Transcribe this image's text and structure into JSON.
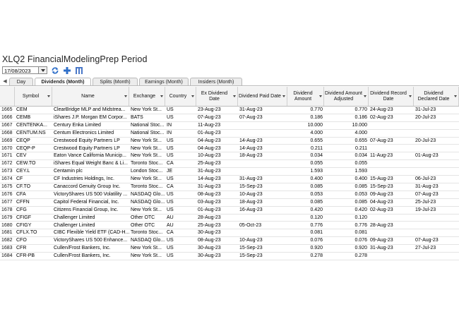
{
  "window": {
    "title": "XLQ2 FinancialModelingPrep Period"
  },
  "toolbar": {
    "date_value": "17/08/2023",
    "icons": [
      "calendar-dropdown-icon",
      "refresh-icon",
      "add-icon",
      "columns-icon"
    ],
    "colors": {
      "refresh": "#2f6fc9",
      "add": "#2f6fc9",
      "columns": "#4a78c8"
    }
  },
  "tabs": [
    {
      "label": "Day"
    },
    {
      "label": "Dividends (Month)",
      "active": true
    },
    {
      "label": "Splits (Month)"
    },
    {
      "label": "Earnings (Month)"
    },
    {
      "label": "Insiders (Month)"
    }
  ],
  "columns": [
    {
      "label": "",
      "filter": false
    },
    {
      "label": "Symbol",
      "filter": true
    },
    {
      "label": "Name",
      "filter": true
    },
    {
      "label": "Exchange",
      "filter": true
    },
    {
      "label": "Country",
      "filter": true
    },
    {
      "label": "Ex Dividend Date",
      "filter": true
    },
    {
      "label": "Dividend Paid Date",
      "filter": true
    },
    {
      "label": "Dividend Amount",
      "filter": true
    },
    {
      "label": "Dividend Amount Adjusted",
      "filter": true
    },
    {
      "label": "Dividend Record Date",
      "filter": true
    },
    {
      "label": "Dividend Declared Date",
      "filter": true
    }
  ],
  "rows": [
    [
      "1665",
      "CEM",
      "ClearBridge MLP and Midstrea...",
      "New York St...",
      "US",
      "23-Aug-23",
      "31-Aug-23",
      "0.770",
      "0.770",
      "24-Aug-23",
      "31-Jul-23"
    ],
    [
      "1666",
      "CEMB",
      "iShares J.P. Morgan EM Corpor...",
      "BATS",
      "US",
      "07-Aug-23",
      "07-Aug-23",
      "0.186",
      "0.186",
      "02-Aug-23",
      "20-Jul-23"
    ],
    [
      "1667",
      "CENTENKA...",
      "Century Enka Limited",
      "National Stoc...",
      "IN",
      "11-Aug-23",
      "",
      "10.000",
      "10.000",
      "",
      ""
    ],
    [
      "1668",
      "CENTUM.NS",
      "Centum Electronics Limited",
      "National Stoc...",
      "IN",
      "01-Aug-23",
      "",
      "4.000",
      "4.000",
      "",
      ""
    ],
    [
      "1669",
      "CEQP",
      "Crestwood Equity Partners LP",
      "New York St...",
      "US",
      "04-Aug-23",
      "14-Aug-23",
      "0.655",
      "0.655",
      "07-Aug-23",
      "20-Jul-23"
    ],
    [
      "1670",
      "CEQP-P",
      "Crestwood Equity Partners LP",
      "New York St...",
      "US",
      "04-Aug-23",
      "14-Aug-23",
      "0.211",
      "0.211",
      "",
      ""
    ],
    [
      "1671",
      "CEV",
      "Eaton Vance California Municip...",
      "New York St...",
      "US",
      "10-Aug-23",
      "18-Aug-23",
      "0.034",
      "0.034",
      "11-Aug-23",
      "01-Aug-23"
    ],
    [
      "1672",
      "CEW.TO",
      "iShares Equal Weight Banc & Li...",
      "Toronto Stoc...",
      "CA",
      "25-Aug-23",
      "",
      "0.055",
      "0.055",
      "",
      ""
    ],
    [
      "1673",
      "CEY.L",
      "Centamin plc",
      "London Stoc...",
      "JE",
      "31-Aug-23",
      "",
      "1.593",
      "1.593",
      "",
      ""
    ],
    [
      "1674",
      "CF",
      "CF Industries Holdings, Inc.",
      "New York St...",
      "US",
      "14-Aug-23",
      "31-Aug-23",
      "0.400",
      "0.400",
      "15-Aug-23",
      "06-Jul-23"
    ],
    [
      "1675",
      "CF.TO",
      "Canaccord Genuity Group Inc.",
      "Toronto Stoc...",
      "CA",
      "31-Aug-23",
      "15-Sep-23",
      "0.085",
      "0.085",
      "15-Sep-23",
      "31-Aug-23"
    ],
    [
      "1676",
      "CFA",
      "VictoryShares US 500 Volatility ...",
      "NASDAQ Glo...",
      "US",
      "08-Aug-23",
      "10-Aug-23",
      "0.053",
      "0.053",
      "09-Aug-23",
      "07-Aug-23"
    ],
    [
      "1677",
      "CFFN",
      "Capitol Federal Financial, Inc.",
      "NASDAQ Glo...",
      "US",
      "03-Aug-23",
      "18-Aug-23",
      "0.085",
      "0.085",
      "04-Aug-23",
      "25-Jul-23"
    ],
    [
      "1678",
      "CFG",
      "Citizens Financial Group, Inc.",
      "New York St...",
      "US",
      "01-Aug-23",
      "16-Aug-23",
      "0.420",
      "0.420",
      "02-Aug-23",
      "19-Jul-23"
    ],
    [
      "1679",
      "CFIGF",
      "Challenger Limited",
      "Other OTC",
      "AU",
      "28-Aug-23",
      "",
      "0.120",
      "0.120",
      "",
      ""
    ],
    [
      "1680",
      "CFIGY",
      "Challenger Limited",
      "Other OTC",
      "AU",
      "25-Aug-23",
      "05-Oct-23",
      "0.776",
      "0.776",
      "28-Aug-23",
      ""
    ],
    [
      "1681",
      "CFLX.TO",
      "CIBC Flexible Yield ETF (CAD-H...",
      "Toronto Stoc...",
      "CA",
      "30-Aug-23",
      "",
      "0.081",
      "0.081",
      "",
      ""
    ],
    [
      "1682",
      "CFO",
      "VictoryShares US 500 Enhance...",
      "NASDAQ Glo...",
      "US",
      "08-Aug-23",
      "10-Aug-23",
      "0.076",
      "0.076",
      "09-Aug-23",
      "07-Aug-23"
    ],
    [
      "1683",
      "CFR",
      "Cullen/Frost Bankers, Inc.",
      "New York St...",
      "US",
      "30-Aug-23",
      "15-Sep-23",
      "0.920",
      "0.920",
      "31-Aug-23",
      "27-Jul-23"
    ],
    [
      "1684",
      "CFR-PB",
      "Cullen/Frost Bankers, Inc.",
      "New York St...",
      "US",
      "30-Aug-23",
      "15-Sep-23",
      "0.278",
      "0.278",
      "",
      ""
    ]
  ]
}
